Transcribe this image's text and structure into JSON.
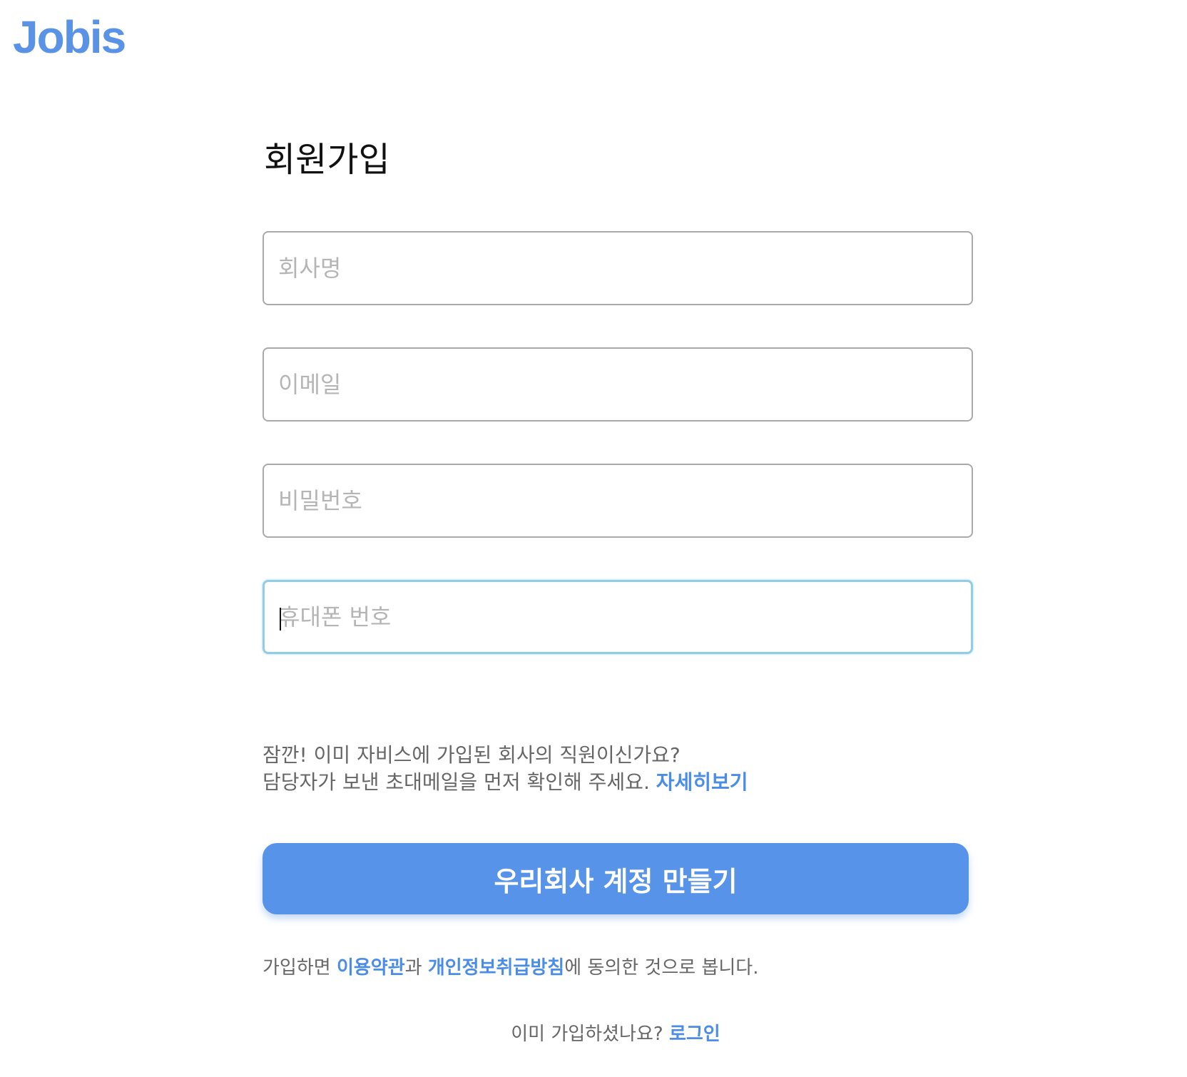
{
  "brand": {
    "logo_text": "Jobis",
    "color": "#5a93e6"
  },
  "page": {
    "title": "회원가입"
  },
  "form": {
    "company_name": {
      "placeholder": "회사명",
      "value": ""
    },
    "email": {
      "placeholder": "이메일",
      "value": ""
    },
    "password": {
      "placeholder": "비밀번호",
      "value": ""
    },
    "phone": {
      "placeholder": "휴대폰 번호",
      "value": "",
      "focused": true
    }
  },
  "notice": {
    "line1": "잠깐! 이미 자비스에 가입된 회사의 직원이신가요?",
    "line2": "담당자가 보낸 초대메일을 먼저 확인해 주세요.",
    "more_link": "자세히보기"
  },
  "submit": {
    "label": "우리회사 계정 만들기",
    "color": "#5793e8"
  },
  "terms": {
    "prefix": "가입하면",
    "terms_link": "이용약관",
    "connector": "과",
    "privacy_link": "개인정보취급방침",
    "suffix": "에 동의한 것으로 봅니다."
  },
  "login": {
    "prompt": "이미 가입하셨나요?",
    "link": "로그인"
  }
}
